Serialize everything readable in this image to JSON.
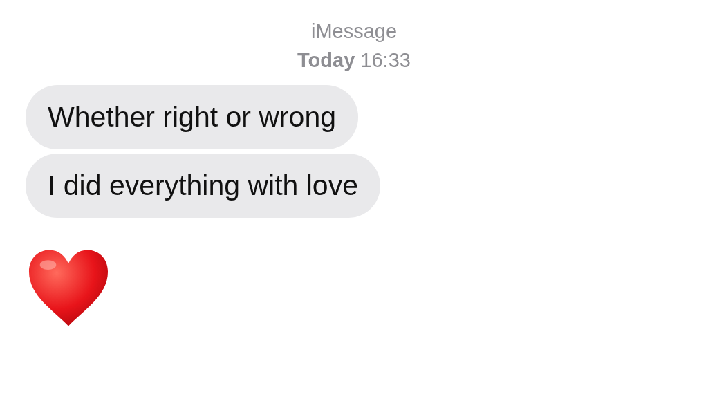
{
  "header": {
    "service": "iMessage",
    "timestamp": "**Today** 16:33"
  },
  "messages": [
    {
      "kind": "text",
      "text": "Whether right or wrong"
    },
    {
      "kind": "text",
      "text": "I did everything with love"
    },
    {
      "kind": "heart"
    }
  ]
}
